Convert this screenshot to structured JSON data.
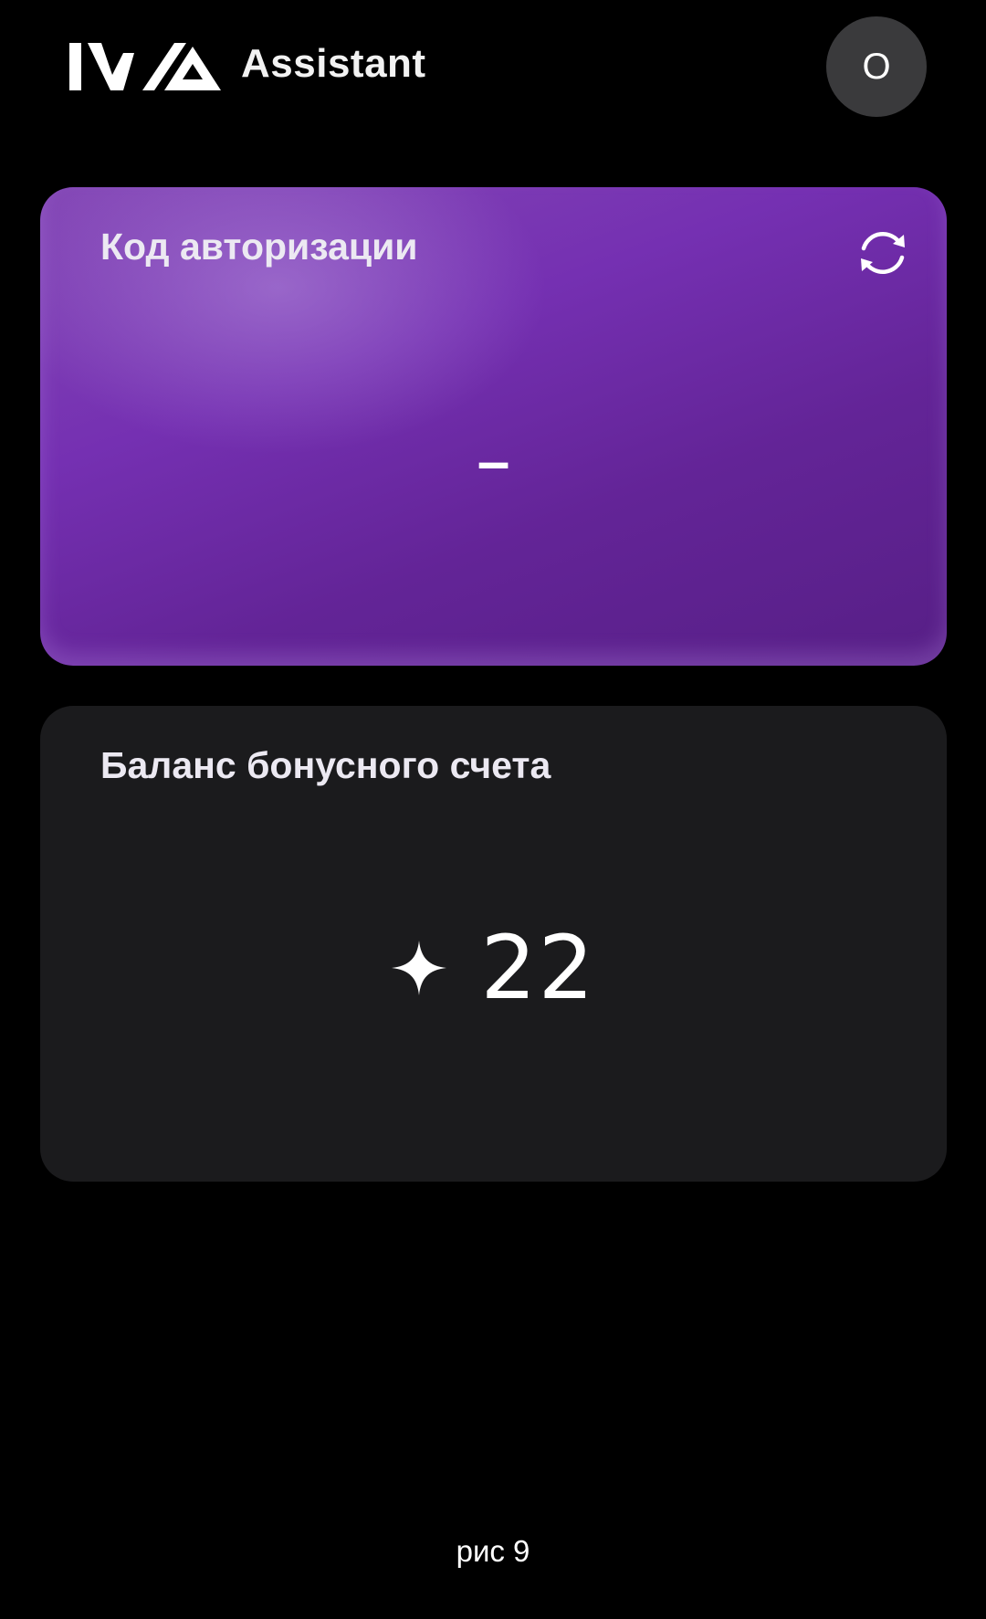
{
  "header": {
    "logo_icon": "iwa-logo",
    "app_title": "Assistant",
    "avatar_initial": "O",
    "avatar_color": "#3a3a3c"
  },
  "auth_card": {
    "title": "Код авторизации",
    "code": "–",
    "refresh_icon": "refresh-icon",
    "accent_color": "#7530b2"
  },
  "balance_card": {
    "title": "Баланс бонусного счета",
    "star_icon": "star-icon",
    "value": "22",
    "background_color": "#1b1b1d"
  },
  "caption": "рис 9"
}
